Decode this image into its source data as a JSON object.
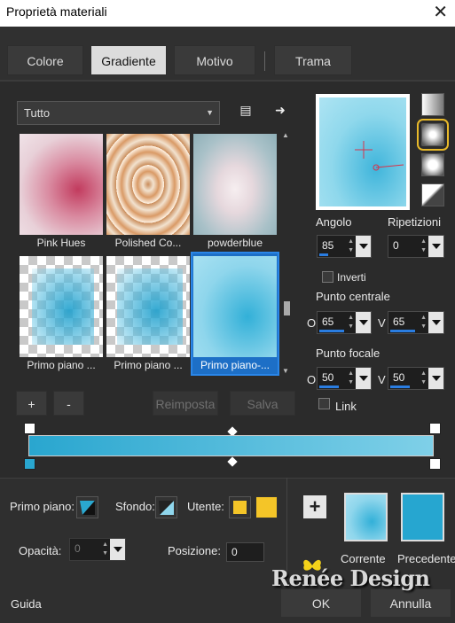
{
  "window": {
    "title": "Proprietà materiali",
    "close_glyph": "✕"
  },
  "tabs": [
    {
      "label": "Colore",
      "active": false
    },
    {
      "label": "Gradiente",
      "active": true
    },
    {
      "label": "Motivo",
      "active": false
    },
    {
      "label": "Trama",
      "active": false
    }
  ],
  "category": {
    "selected": "Tutto",
    "caret": "▼"
  },
  "toolbar_icons": {
    "menu_icon": "▤",
    "arrow_icon": "➜"
  },
  "gallery": {
    "items": [
      {
        "label": "Pink Hues",
        "selected": false
      },
      {
        "label": "Polished Co...",
        "selected": false
      },
      {
        "label": "powderblue",
        "selected": false
      },
      {
        "label": "Primo piano ...",
        "selected": false
      },
      {
        "label": "Primo piano ...",
        "selected": false
      },
      {
        "label": "Primo piano-...",
        "selected": true
      }
    ]
  },
  "scroll": {
    "up": "▲",
    "down": "▼"
  },
  "buttons": {
    "add": "+",
    "remove": "-",
    "reset": "Reimposta",
    "save": "Salva",
    "plus_icon": "+",
    "ok": "OK",
    "cancel": "Annulla",
    "help": "Guida"
  },
  "gradient_colors": {
    "start": "#29a6cf",
    "end": "#7fd0e8",
    "accent_selection": "#1d6fc6",
    "highlight_ring": "#e8b92a",
    "swatch_yellow": "#f4c528"
  },
  "properties": {
    "angle_label": "Angolo",
    "angle_value": "85",
    "repeats_label": "Ripetizioni",
    "repeats_value": "0",
    "invert_label": "Inverti",
    "center_label": "Punto centrale",
    "center_h_label": "O",
    "center_h_value": "65",
    "center_v_label": "V",
    "center_v_value": "65",
    "focal_label": "Punto focale",
    "focal_h_label": "O",
    "focal_h_value": "50",
    "focal_v_label": "V",
    "focal_v_value": "50",
    "link_label": "Link"
  },
  "bottom": {
    "foreground_label": "Primo piano:",
    "background_label": "Sfondo:",
    "user_label": "Utente:",
    "opacity_label": "Opacità:",
    "opacity_value": "0",
    "position_label": "Posizione:",
    "position_value": "0",
    "current_label": "Corrente",
    "previous_label": "Precedente"
  },
  "watermark": "Renée Design"
}
